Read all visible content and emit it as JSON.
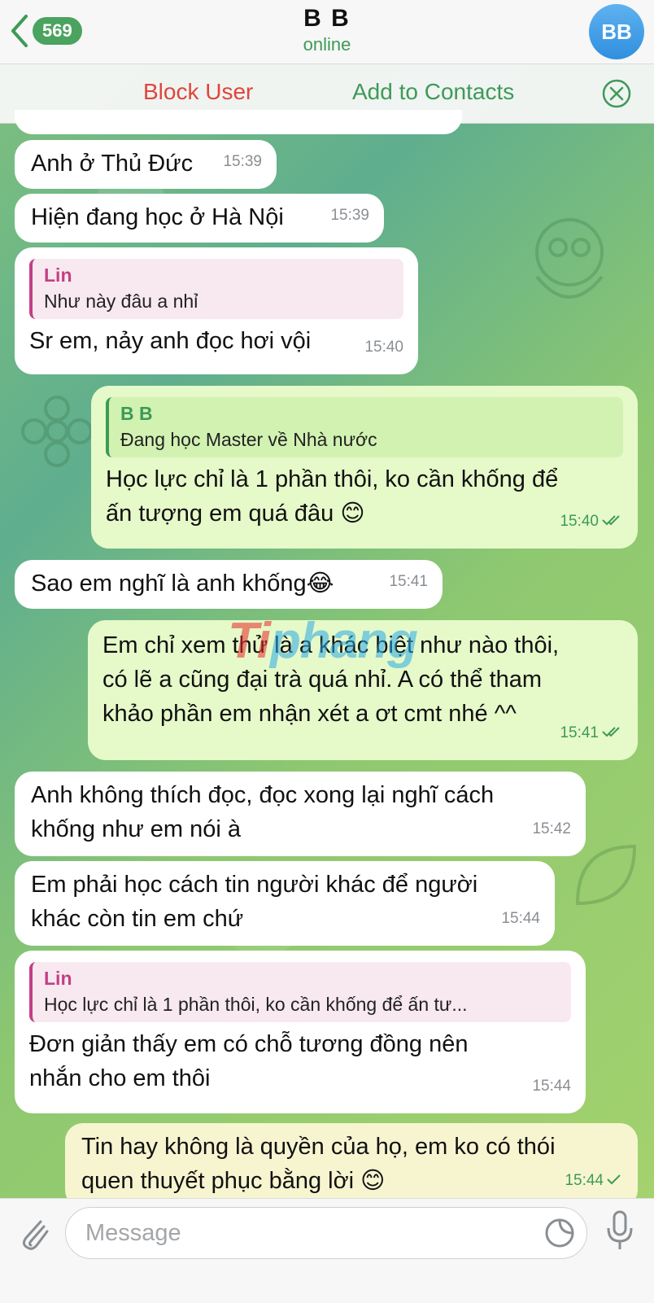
{
  "header": {
    "back_count": "569",
    "title": "B B",
    "status": "online",
    "avatar_initials": "BB"
  },
  "actionbar": {
    "block_label": "Block User",
    "add_label": "Add to Contacts"
  },
  "messages": [
    {
      "dir": "in",
      "text": "Anh ở Thủ Đức",
      "time": "15:39"
    },
    {
      "dir": "in",
      "text": "Hiện đang học ở Hà Nội",
      "time": "15:39"
    },
    {
      "dir": "in",
      "reply_name": "Lin",
      "reply_text": "Như này đâu a nhỉ",
      "text": "Sr em, nảy anh đọc hơi vội",
      "time": "15:40"
    },
    {
      "dir": "out",
      "reply_name": "B B",
      "reply_text": "Đang học Master về Nhà nước",
      "text_line1": "Học lực chỉ là 1 phần thôi, ko cần khống để",
      "text_line2": "ấn tượng em quá đâu 😊",
      "time": "15:40"
    },
    {
      "dir": "in",
      "text": "Sao em nghĩ là anh khống😂",
      "time": "15:41"
    },
    {
      "dir": "out",
      "text_line1": "Em chỉ xem thử là a khác biệt như nào thôi,",
      "text_line2": "có lẽ a cũng đại trà quá nhỉ. A có thể tham",
      "text_line3": "khảo phần em nhận xét a ơt cmt nhé ^^",
      "time": "15:41"
    },
    {
      "dir": "in",
      "text_line1": "Anh không thích đọc, đọc xong lại nghĩ cách",
      "text_line2": "khống như em nói à",
      "time": "15:42"
    },
    {
      "dir": "in",
      "text_line1": "Em phải học cách tin người khác để người",
      "text_line2": "khác còn tin em chứ",
      "time": "15:44"
    },
    {
      "dir": "in",
      "reply_name": "Lin",
      "reply_text": "Học lực chỉ là 1 phần thôi, ko cần khống để ấn tư...",
      "text_line1": "Đơn giản thấy em có chỗ tương đồng nên",
      "text_line2": "nhắn cho em thôi",
      "time": "15:44"
    },
    {
      "dir": "out",
      "text_line1": "Tin hay không là quyền của họ, em ko có thói",
      "text_line2": "quen thuyết phục bằng lời 😊",
      "time": "15:44"
    }
  ],
  "watermark": {
    "part1": "Ti",
    "part2": "phang"
  },
  "input": {
    "placeholder": "Message"
  },
  "colors": {
    "accent_green": "#3d9a57",
    "block_red": "#e0453b",
    "outgoing_bubble": "#e6f9c9",
    "avatar_blue": "#2f8fe0"
  },
  "icons": [
    "back-chevron-icon",
    "close-icon",
    "attach-icon",
    "sticker-icon",
    "mic-icon",
    "double-check-icon",
    "check-icon"
  ]
}
